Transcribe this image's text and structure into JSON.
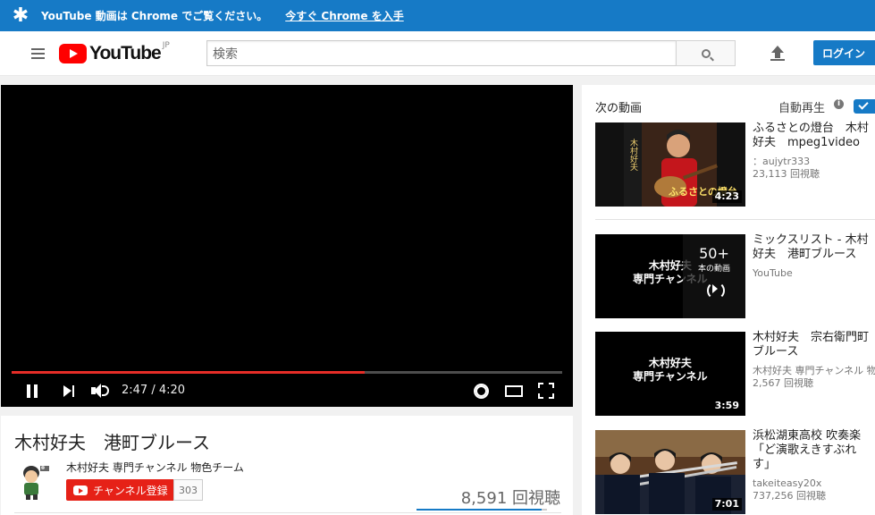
{
  "promo": {
    "message": "YouTube 動画は Chrome でご覧ください。",
    "cta": "今すぐ Chrome を入手"
  },
  "masthead": {
    "logo_text": "YouTube",
    "country_code": "JP",
    "search_placeholder": "検索",
    "login_label": "ログイン"
  },
  "player": {
    "time": "2:47 / 4:20",
    "progress_fraction": 0.642
  },
  "video": {
    "title": "木村好夫　港町ブルース",
    "channel": "木村好夫 専門チャンネル 物色チーム",
    "subscribe_label": "チャンネル登録",
    "subscriber_count": "303",
    "views": "8,591 回視聴",
    "like_ratio": 0.96
  },
  "sidebar": {
    "up_next": "次の動画",
    "autoplay": "自動再生",
    "info_glyph": "i",
    "items": [
      {
        "title_line1": "ふるさとの燈台　木村",
        "title_line2": "好夫　mpeg1video",
        "meta1": "：aujytr333",
        "meta2": "23,113 回視聴",
        "duration": "4:23",
        "thumb_caption": "ふるさとの燈台"
      },
      {
        "title_line1": "ミックスリスト - 木村",
        "title_line2": "好夫　港町ブルース",
        "meta1": "YouTube",
        "meta2": "",
        "thumb_text_1": "木村好夫",
        "thumb_text_2": "専門チャンネル",
        "mix_count": "50+",
        "mix_sub": "本の動画"
      },
      {
        "title_line1": "木村好夫　宗右衛門町",
        "title_line2": "ブルース",
        "meta1": "木村好夫 専門チャンネル 物",
        "meta2": "2,567 回視聴",
        "duration": "3:59",
        "thumb_text_1": "木村好夫",
        "thumb_text_2": "専門チャンネル"
      },
      {
        "title_line1": "浜松湖東高校 吹奏楽",
        "title_line2": "「ど演歌えきすぶれ",
        "title_line3": "す」",
        "meta1": "takeiteasy20x",
        "meta2": "737,256 回視聴",
        "duration": "7:01"
      }
    ]
  },
  "colors": {
    "brand_blue": "#167ac6",
    "youtube_red": "#ff0000",
    "progress_red": "#e52d27"
  }
}
